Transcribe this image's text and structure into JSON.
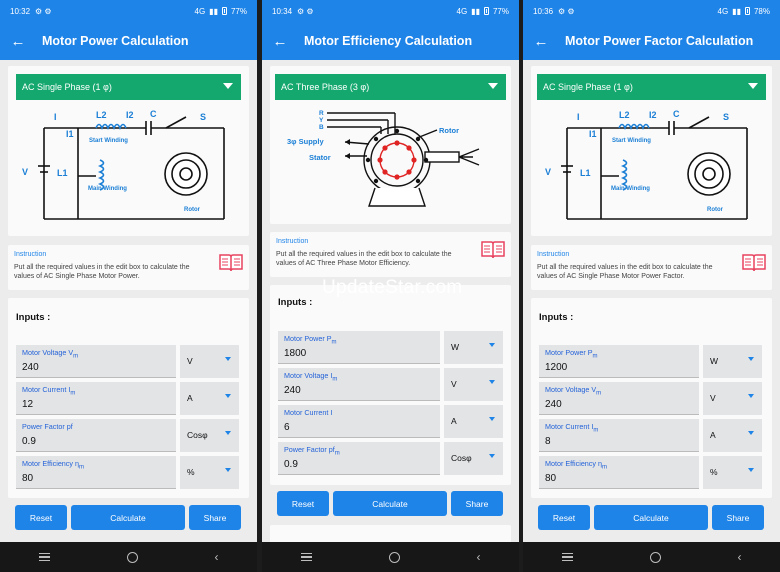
{
  "watermark": "UpdateStar.com",
  "phones": [
    {
      "status": {
        "time": "10:32",
        "signal": "4G",
        "battery": "77%"
      },
      "title": "Motor Power Calculation",
      "phase": "AC Single Phase (1 φ)",
      "diagram": {
        "I": "I",
        "I1": "I1",
        "I2": "I2",
        "L1": "L1",
        "L2": "L2",
        "C": "C",
        "S": "S",
        "V": "V",
        "start_winding": "Start Winding",
        "main_winding": "Main Winding",
        "rotor": "Rotor"
      },
      "instruction_title": "Instruction",
      "instruction_text": "Put all the required values in the edit box to calculate the values of AC Single Phase Motor Power.",
      "inputs_label": "Inputs :",
      "fields": [
        {
          "label": "Motor Voltage V",
          "sub": "m",
          "value": "240",
          "unit": "V"
        },
        {
          "label": "Motor Current I",
          "sub": "m",
          "value": "12",
          "unit": "A"
        },
        {
          "label": "Power Factor pf",
          "sub": "",
          "value": "0.9",
          "unit": "Cosφ"
        },
        {
          "label": "Motor Efficiency η",
          "sub": "m",
          "value": "80",
          "unit": "%"
        }
      ],
      "buttons": {
        "reset": "Reset",
        "calculate": "Calculate",
        "share": "Share"
      }
    },
    {
      "status": {
        "time": "10:34",
        "signal": "4G",
        "battery": "77%"
      },
      "title": "Motor Efficiency Calculation",
      "phase": "AC Three Phase (3 φ)",
      "diagram": {
        "R": "R",
        "Y": "Y",
        "B": "B",
        "supply": "3φ Supply",
        "rotor": "Rotor",
        "stator": "Stator"
      },
      "instruction_title": "Instruction",
      "instruction_text": "Put all the required values in the edit box to calculate the values of AC Three Phase Motor Efficiency.",
      "inputs_label": "Inputs :",
      "fields": [
        {
          "label": "Motor Power P",
          "sub": "m",
          "value": "1800",
          "unit": "W"
        },
        {
          "label": "Motor Voltage I",
          "sub": "m",
          "value": "240",
          "unit": "V"
        },
        {
          "label": "Motor Current I",
          "sub": "",
          "value": "6",
          "unit": "A"
        },
        {
          "label": "Power Factor pf",
          "sub": "m",
          "value": "0.9",
          "unit": "Cosφ"
        }
      ],
      "buttons": {
        "reset": "Reset",
        "calculate": "Calculate",
        "share": "Share"
      }
    },
    {
      "status": {
        "time": "10:36",
        "signal": "4G",
        "battery": "78%"
      },
      "title": "Motor Power Factor Calculation",
      "phase": "AC Single Phase (1 φ)",
      "diagram": {
        "I": "I",
        "I1": "I1",
        "I2": "I2",
        "L1": "L1",
        "L2": "L2",
        "C": "C",
        "S": "S",
        "V": "V",
        "start_winding": "Start Winding",
        "main_winding": "Main Winding",
        "rotor": "Rotor"
      },
      "instruction_title": "Instruction",
      "instruction_text": "Put all the required values in the edit box to calculate the values of AC Single Phase Motor Power Factor.",
      "inputs_label": "Inputs :",
      "fields": [
        {
          "label": "Motor Power P",
          "sub": "m",
          "value": "1200",
          "unit": "W"
        },
        {
          "label": "Motor Voltage V",
          "sub": "m",
          "value": "240",
          "unit": "V"
        },
        {
          "label": "Motor Current I",
          "sub": "m",
          "value": "8",
          "unit": "A"
        },
        {
          "label": "Motor Efficiency η",
          "sub": "m",
          "value": "80",
          "unit": "%"
        }
      ],
      "buttons": {
        "reset": "Reset",
        "calculate": "Calculate",
        "share": "Share"
      }
    }
  ]
}
